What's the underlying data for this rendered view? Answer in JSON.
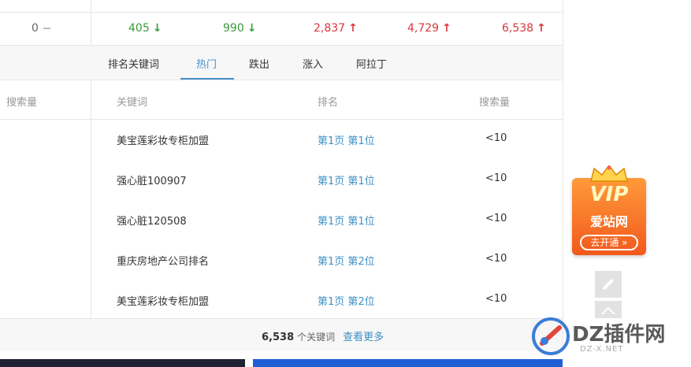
{
  "stats": {
    "first_value": "0",
    "items": [
      {
        "value": "405",
        "direction": "down"
      },
      {
        "value": "990",
        "direction": "down"
      },
      {
        "value": "2,837",
        "direction": "up"
      },
      {
        "value": "4,729",
        "direction": "up"
      },
      {
        "value": "6,538",
        "direction": "up"
      }
    ]
  },
  "tabs": [
    "排名关键词",
    "热门",
    "跌出",
    "涨入",
    "阿拉丁"
  ],
  "active_tab": "热门",
  "left_header": "搜索量",
  "table": {
    "headers": {
      "keyword": "关键词",
      "rank": "排名",
      "volume": "搜索量"
    },
    "rows": [
      {
        "keyword": "美宝莲彩妆专柜加盟",
        "rank": "第1页 第1位",
        "volume": "<10"
      },
      {
        "keyword": "强心脏100907",
        "rank": "第1页 第1位",
        "volume": "<10"
      },
      {
        "keyword": "强心脏120508",
        "rank": "第1页 第1位",
        "volume": "<10"
      },
      {
        "keyword": "重庆房地产公司排名",
        "rank": "第1页 第2位",
        "volume": "<10"
      },
      {
        "keyword": "美宝莲彩妆专柜加盟",
        "rank": "第1页 第2位",
        "volume": "<10"
      }
    ]
  },
  "footer": {
    "count": "6,538",
    "suffix": "个关键词",
    "more_link": "查看更多"
  },
  "vip_badge": {
    "title": "VIP",
    "subtitle": "爱站网",
    "button": "去开通 »"
  },
  "side_buttons": [
    "edit-icon",
    "back-to-top-icon"
  ],
  "watermark": {
    "text": "DZ插件网",
    "sub": "DZ-X.NET"
  },
  "colors": {
    "down": "#3a9b3a",
    "up": "#d9363e",
    "link": "#3e8fc4",
    "tab_active": "#4a90c8"
  }
}
